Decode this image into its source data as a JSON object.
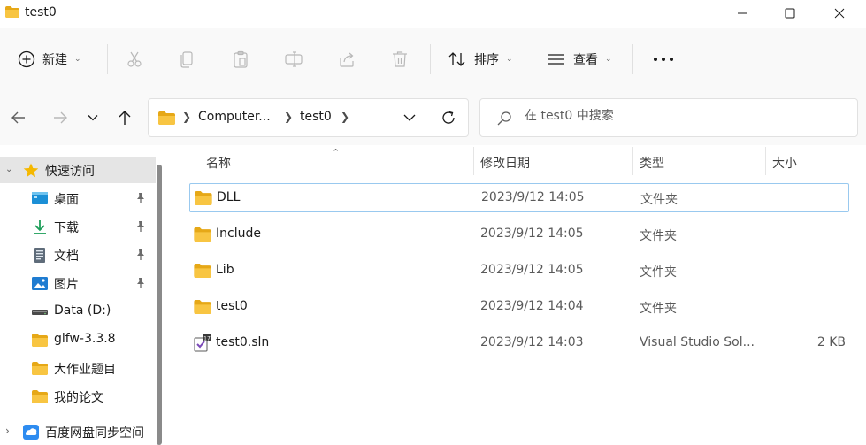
{
  "window": {
    "title": "test0",
    "icon": "folder-icon"
  },
  "toolbar": {
    "new_label": "新建",
    "sort_label": "排序",
    "view_label": "查看",
    "more_label": "···"
  },
  "address": {
    "crumbs": [
      "Computer...",
      "test0"
    ]
  },
  "search": {
    "placeholder": "在 test0 中搜索"
  },
  "sidebar": {
    "quick_access": "快速访问",
    "items": [
      {
        "label": "桌面",
        "icon": "desktop-icon",
        "pinned": true
      },
      {
        "label": "下载",
        "icon": "download-icon",
        "pinned": true
      },
      {
        "label": "文档",
        "icon": "document-icon",
        "pinned": true
      },
      {
        "label": "图片",
        "icon": "pictures-icon",
        "pinned": true
      },
      {
        "label": "Data (D:)",
        "icon": "drive-icon",
        "pinned": false
      },
      {
        "label": "glfw-3.3.8",
        "icon": "folder-icon",
        "pinned": false
      },
      {
        "label": "大作业题目",
        "icon": "folder-icon",
        "pinned": false
      },
      {
        "label": "我的论文",
        "icon": "folder-icon",
        "pinned": false
      }
    ],
    "baidu": "百度网盘同步空间"
  },
  "columns": {
    "name": "名称",
    "modified": "修改日期",
    "type": "类型",
    "size": "大小"
  },
  "files": [
    {
      "name": "DLL",
      "modified": "2023/9/12 14:05",
      "type": "文件夹",
      "size": "",
      "icon": "folder-icon"
    },
    {
      "name": "Include",
      "modified": "2023/9/12 14:05",
      "type": "文件夹",
      "size": "",
      "icon": "folder-icon"
    },
    {
      "name": "Lib",
      "modified": "2023/9/12 14:05",
      "type": "文件夹",
      "size": "",
      "icon": "folder-icon"
    },
    {
      "name": "test0",
      "modified": "2023/9/12 14:04",
      "type": "文件夹",
      "size": "",
      "icon": "folder-icon"
    },
    {
      "name": "test0.sln",
      "modified": "2023/9/12 14:03",
      "type": "Visual Studio Sol...",
      "size": "2 KB",
      "icon": "visual-studio-solution-icon"
    }
  ],
  "colors": {
    "folder": "#f8c542",
    "folder_dark": "#e6a817",
    "selection_border": "#99c9ef",
    "sidebar_selected": "#e5e5e5",
    "star": "#f5b800"
  }
}
